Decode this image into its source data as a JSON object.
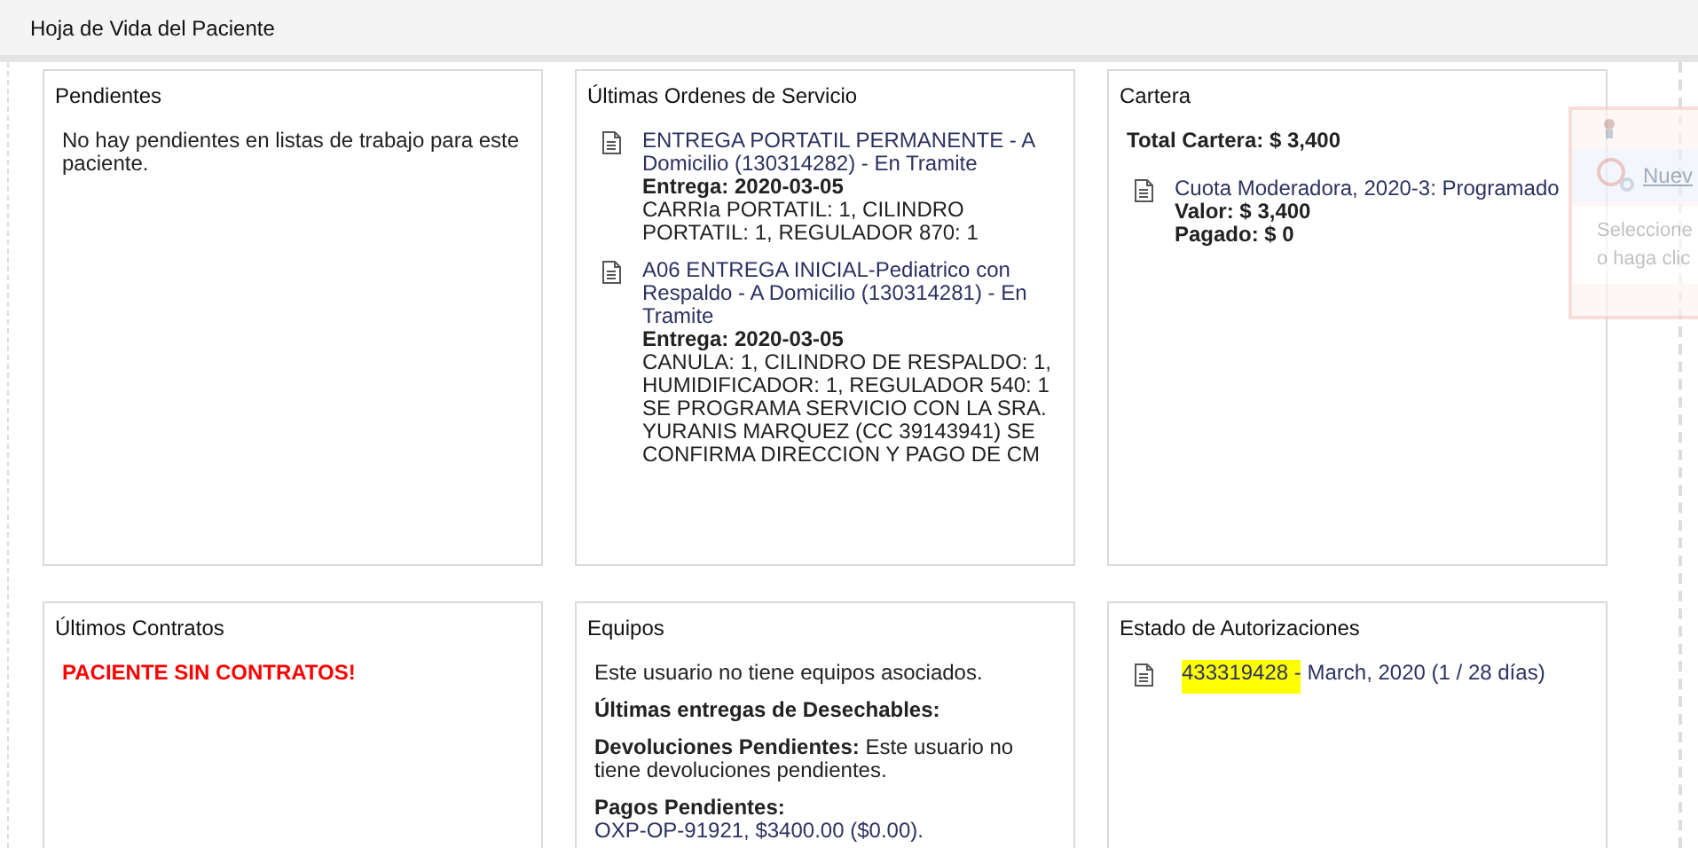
{
  "page_title": "Hoja de Vida del Paciente",
  "cards": [
    {
      "title": "Pendientes",
      "items": [
        {
          "kind": "text",
          "text": "No hay pendientes en listas de trabajo para este paciente."
        }
      ]
    },
    {
      "title": "Últimas Ordenes de Servicio",
      "items": [
        {
          "kind": "doc",
          "lines": [
            {
              "kind": "link",
              "text": "ENTREGA PORTATIL PERMANENTE - A Domicilio (130314282) - En Tramite"
            },
            {
              "kind": "bold",
              "text": "Entrega: 2020-03-05"
            },
            {
              "kind": "plain",
              "text": "CARRIa PORTATIL: 1, CILINDRO PORTATIL: 1, REGULADOR 870: 1"
            }
          ]
        },
        {
          "kind": "doc",
          "lines": [
            {
              "kind": "link",
              "text": "A06 ENTREGA INICIAL-Pediatrico con Respaldo - A Domicilio (130314281) - En Tramite"
            },
            {
              "kind": "bold",
              "text": "Entrega: 2020-03-05"
            },
            {
              "kind": "plain",
              "text": "CANULA: 1, CILINDRO DE RESPALDO: 1, HUMIDIFICADOR: 1, REGULADOR 540: 1 SE PROGRAMA SERVICIO CON LA SRA. YURANIS MARQUEZ (CC 39143941) SE CONFIRMA DIRECCION Y PAGO DE CM"
            }
          ]
        }
      ]
    },
    {
      "title": "Cartera",
      "items": [
        {
          "kind": "total",
          "text": "Total Cartera: $ 3,400"
        },
        {
          "kind": "doc",
          "lines": [
            {
              "kind": "link",
              "text": "Cuota Moderadora, 2020-3: Programado"
            },
            {
              "kind": "bold",
              "text": "Valor: $ 3,400"
            },
            {
              "kind": "bold",
              "text": "Pagado: $ 0"
            }
          ]
        }
      ]
    },
    {
      "title": "Últimos Contratos",
      "items": [
        {
          "kind": "alert",
          "text": "PACIENTE SIN CONTRATOS!"
        }
      ]
    },
    {
      "title": "Equipos",
      "items": [
        {
          "kind": "text",
          "text": "Este usuario no tiene equipos asociados."
        },
        {
          "kind": "text",
          "text": "**Últimas entregas de Desechables:**"
        },
        {
          "kind": "text",
          "text": "**Devoluciones Pendientes:** Este usuario no tiene devoluciones pendientes."
        },
        {
          "kind": "plain-group",
          "lines": [
            {
              "kind": "bold",
              "text": "Pagos Pendientes:"
            },
            {
              "kind": "link",
              "text": "OXP-OP-91921, $3400.00 ($0.00)."
            }
          ]
        }
      ]
    },
    {
      "title": "Estado de Autorizaciones",
      "items": [
        {
          "kind": "auth",
          "number": "433319428 -",
          "highlighted": true,
          "text": "March, 2020 (1 / 28 días)"
        }
      ]
    }
  ],
  "side_popup": {
    "link": "Nuev",
    "lines": [
      "Seleccione",
      "o haga clic"
    ]
  }
}
